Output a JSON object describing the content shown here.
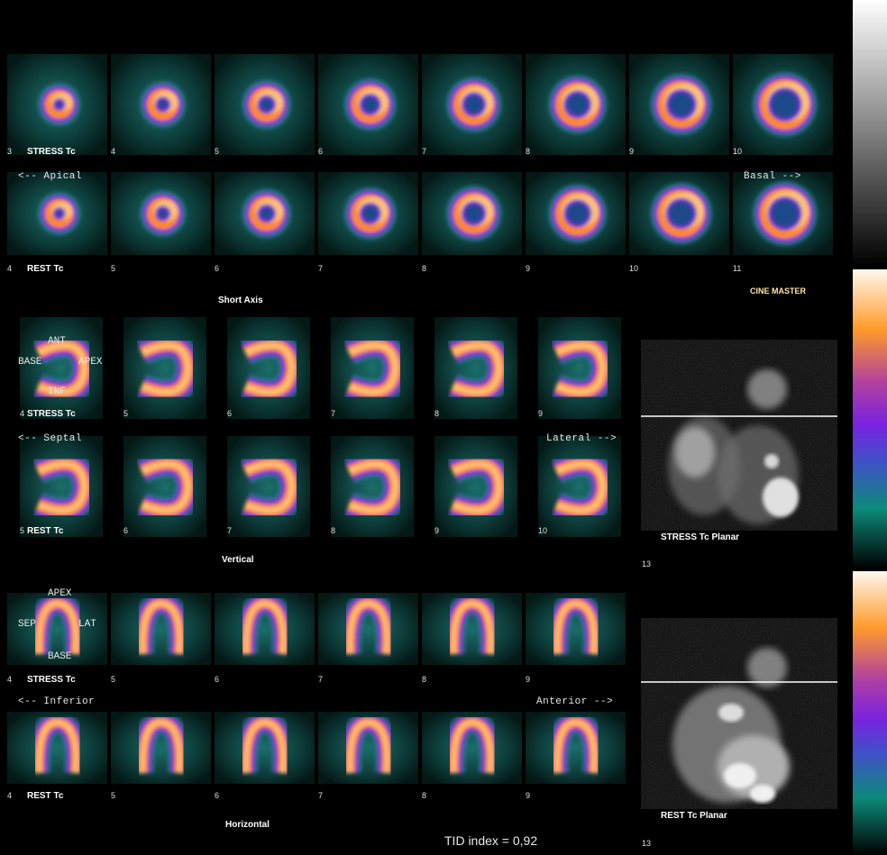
{
  "short_axis": {
    "stress_numbers": [
      "3",
      "4",
      "5",
      "6",
      "7",
      "8",
      "9",
      "10"
    ],
    "rest_numbers": [
      "4",
      "5",
      "6",
      "7",
      "8",
      "9",
      "10",
      "11"
    ],
    "stress_label": "STRESS Tc",
    "rest_label": "REST Tc",
    "left_arrow": "<-- Apical",
    "right_arrow": "Basal -->",
    "section_title": "Short Axis"
  },
  "vertical": {
    "stress_numbers": [
      "4",
      "5",
      "6",
      "7",
      "8",
      "9"
    ],
    "rest_numbers": [
      "5",
      "6",
      "7",
      "8",
      "9",
      "10"
    ],
    "stress_label": "STRESS Tc",
    "rest_label": "REST Tc",
    "left_arrow": "<-- Septal",
    "right_arrow": "Lateral -->",
    "section_title": "Vertical",
    "orient": {
      "top": "ANT",
      "left": "BASE",
      "right": "APEX",
      "bottom": "INF"
    }
  },
  "horizontal": {
    "stress_numbers": [
      "4",
      "5",
      "6",
      "7",
      "8",
      "9"
    ],
    "rest_numbers": [
      "4",
      "5",
      "6",
      "7",
      "8",
      "9"
    ],
    "stress_label": "STRESS Tc",
    "rest_label": "REST Tc",
    "left_arrow": "<-- Inferior",
    "right_arrow": "Anterior -->",
    "section_title": "Horizontal",
    "orient": {
      "top": "APEX",
      "left": "SEP",
      "right": "LAT",
      "bottom": "BASE"
    }
  },
  "cine_master": "CINE MASTER",
  "stress_planar": {
    "label": "STRESS Tc Planar",
    "number": "13"
  },
  "rest_planar": {
    "label": "REST Tc Planar",
    "number": "13"
  },
  "tid_index": "TID index = 0,92",
  "colors": {
    "teal": "#0c8a7a",
    "purple": "#7a28d8",
    "orange": "#ff8a1a",
    "white": "#fff3d8"
  }
}
